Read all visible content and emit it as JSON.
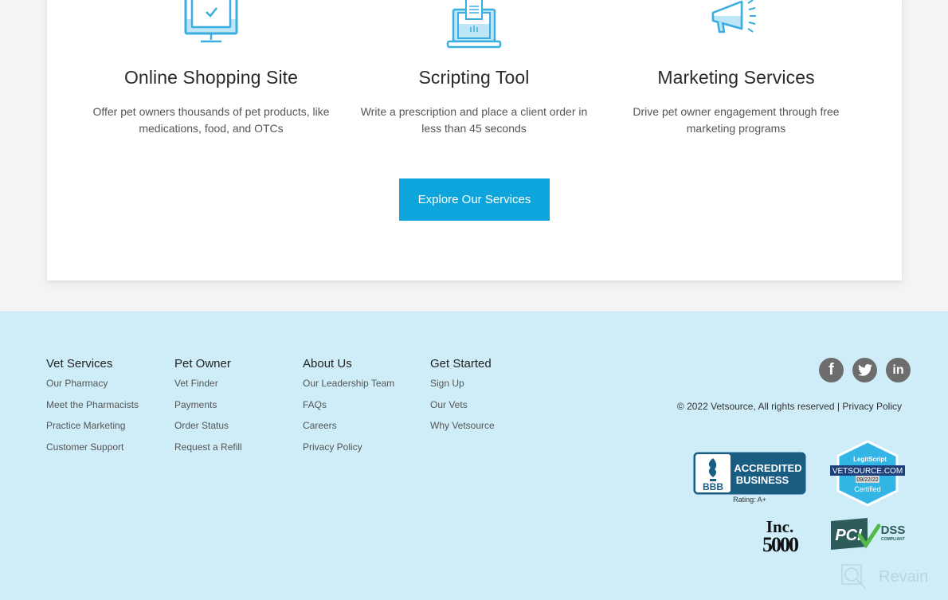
{
  "features": [
    {
      "icon": "monitor-check-icon",
      "title": "Online Shopping Site",
      "description": "Offer pet owners thousands of pet products, like medications, food, and OTCs"
    },
    {
      "icon": "laptop-prescription-icon",
      "title": "Scripting Tool",
      "description": "Write a prescription and place a client order in less than 45 seconds"
    },
    {
      "icon": "megaphone-icon",
      "title": "Marketing Services",
      "description": "Drive pet owner engagement through free marketing programs"
    }
  ],
  "cta": {
    "label": "Explore Our Services"
  },
  "footer": {
    "columns": [
      {
        "heading": "Vet Services",
        "links": [
          "Our Pharmacy",
          "Meet the Pharmacists",
          "Practice Marketing",
          "Customer Support"
        ]
      },
      {
        "heading": "Pet Owner",
        "links": [
          "Vet Finder",
          "Payments",
          "Order Status",
          "Request a Refill"
        ]
      },
      {
        "heading": "About Us",
        "links": [
          "Our Leadership Team",
          "FAQs",
          "Careers",
          "Privacy Policy"
        ]
      },
      {
        "heading": "Get Started",
        "links": [
          "Sign Up",
          "Our Vets",
          "Why Vetsource"
        ]
      }
    ],
    "social": [
      {
        "name": "facebook-icon",
        "glyph": "f"
      },
      {
        "name": "twitter-icon",
        "glyph": "t"
      },
      {
        "name": "linkedin-icon",
        "glyph": "in"
      }
    ],
    "copyright": "© 2022 Vetsource, All rights reserved |",
    "privacy_link": "Privacy Policy",
    "badges": {
      "bbb": {
        "line1": "ACCREDITED",
        "line2": "BUSINESS",
        "logo": "BBB",
        "rating": "Rating: A+"
      },
      "legitscript": {
        "brand": "LegitScript",
        "domain": "VETSOURCE.COM",
        "date": "09/22/22",
        "status": "Certified"
      },
      "inc": {
        "line1": "Inc.",
        "line2": "5000"
      },
      "pci": {
        "logo": "PCI",
        "line1": "DSS",
        "line2": "COMPLIANT"
      }
    },
    "watermark": "Revain"
  },
  "colors": {
    "accent": "#0ea5dc",
    "footer_bg": "#ceedf8",
    "icon_blue": "#3aaee0",
    "social_grey": "#6d6d6d",
    "bbb_blue": "#1a5d83",
    "legit_blue": "#33b5e5"
  }
}
